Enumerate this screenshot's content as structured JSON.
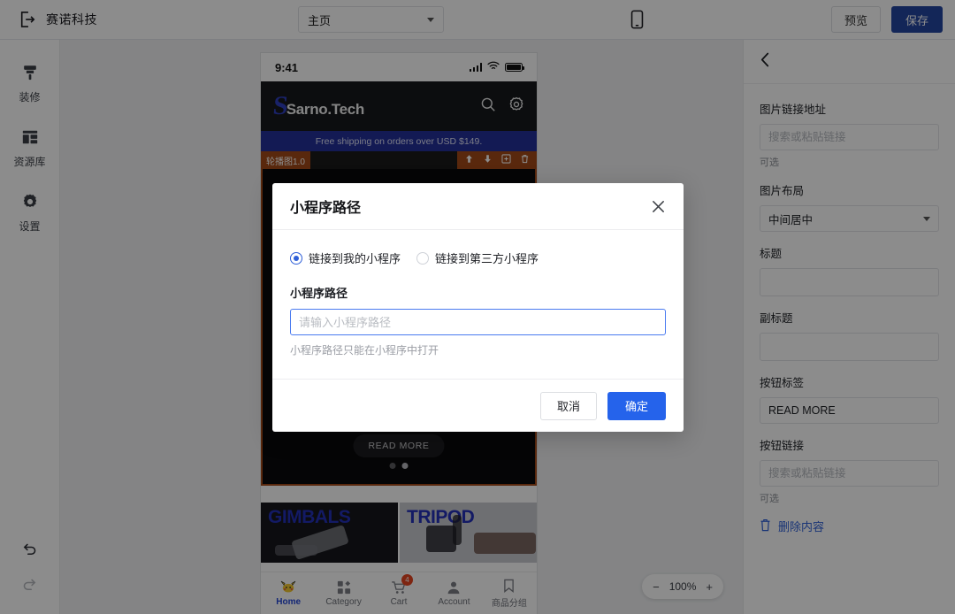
{
  "topbar": {
    "exit_icon": "exit-icon",
    "brand": "赛诺科技",
    "page_select_value": "主页",
    "device_icon": "mobile-device-icon",
    "preview_label": "预览",
    "save_label": "保存",
    "save_color": "#2346a0"
  },
  "sidebar": {
    "items": [
      {
        "icon": "brush-icon",
        "label": "装修"
      },
      {
        "icon": "layout-library-icon",
        "label": "资源库"
      },
      {
        "icon": "gear-icon",
        "label": "设置"
      }
    ],
    "undo_icon": "undo-arrow-icon",
    "redo_icon": "redo-arrow-icon"
  },
  "phone": {
    "status": {
      "time": "9:41",
      "signal_icon": "cellular-signal-icon",
      "wifi_icon": "wifi-icon",
      "battery_icon": "battery-full-icon"
    },
    "shop": {
      "logo_mark": "S",
      "logo_text": "Sarno.Tech",
      "search_icon": "search-icon",
      "settings_icon": "gear-icon",
      "shipping_banner": "Free shipping on orders over USD $149."
    },
    "selection": {
      "tag": "轮播图1.0",
      "tools": [
        "move-up-icon",
        "move-down-icon",
        "duplicate-icon",
        "delete-icon"
      ],
      "accent": "#a24a18"
    },
    "carousel": {
      "button_label": "READ MORE",
      "dot_count": 2,
      "active_dot": 1
    },
    "categories": [
      {
        "title": "GIMBALS",
        "theme": "dark"
      },
      {
        "title": "TRIPOD",
        "theme": "light"
      }
    ],
    "tabbar": [
      {
        "icon": "pikachu-home-icon",
        "label": "Home",
        "active": true,
        "badge": ""
      },
      {
        "icon": "grid-category-icon",
        "label": "Category",
        "active": false,
        "badge": ""
      },
      {
        "icon": "cart-icon",
        "label": "Cart",
        "active": false,
        "badge": "4"
      },
      {
        "icon": "account-person-icon",
        "label": "Account",
        "active": false,
        "badge": ""
      },
      {
        "icon": "bookmark-icon",
        "label": "商品分组",
        "active": false,
        "badge": ""
      }
    ]
  },
  "zoom_control": {
    "minus": "−",
    "value": "100%",
    "plus": "+"
  },
  "right_panel": {
    "back_icon": "chevron-left-icon",
    "fields": [
      {
        "name": "image-link-url",
        "label": "图片链接地址",
        "type": "input",
        "value": "",
        "placeholder": "搜索或粘贴链接",
        "hint": "可选"
      },
      {
        "name": "image-layout",
        "label": "图片布局",
        "type": "select",
        "value": "中间居中",
        "placeholder": "",
        "hint": ""
      },
      {
        "name": "title",
        "label": "标题",
        "type": "textarea",
        "value": "",
        "placeholder": "",
        "hint": ""
      },
      {
        "name": "subtitle",
        "label": "副标题",
        "type": "textarea",
        "value": "",
        "placeholder": "",
        "hint": ""
      },
      {
        "name": "button-label",
        "label": "按钮标签",
        "type": "input",
        "value": "READ MORE",
        "placeholder": "",
        "hint": ""
      },
      {
        "name": "button-link",
        "label": "按钮链接",
        "type": "input",
        "value": "",
        "placeholder": "搜索或粘贴链接",
        "hint": "可选"
      }
    ],
    "delete_icon": "trash-icon",
    "delete_label": "删除内容"
  },
  "modal": {
    "title": "小程序路径",
    "close_icon": "close-icon",
    "radios": [
      {
        "label": "链接到我的小程序",
        "selected": true
      },
      {
        "label": "链接到第三方小程序",
        "selected": false
      }
    ],
    "field_label": "小程序路径",
    "field_value": "",
    "field_placeholder": "请输入小程序路径",
    "hint": "小程序路径只能在小程序中打开",
    "cancel_label": "取消",
    "confirm_label": "确定",
    "confirm_color": "#2563eb"
  }
}
